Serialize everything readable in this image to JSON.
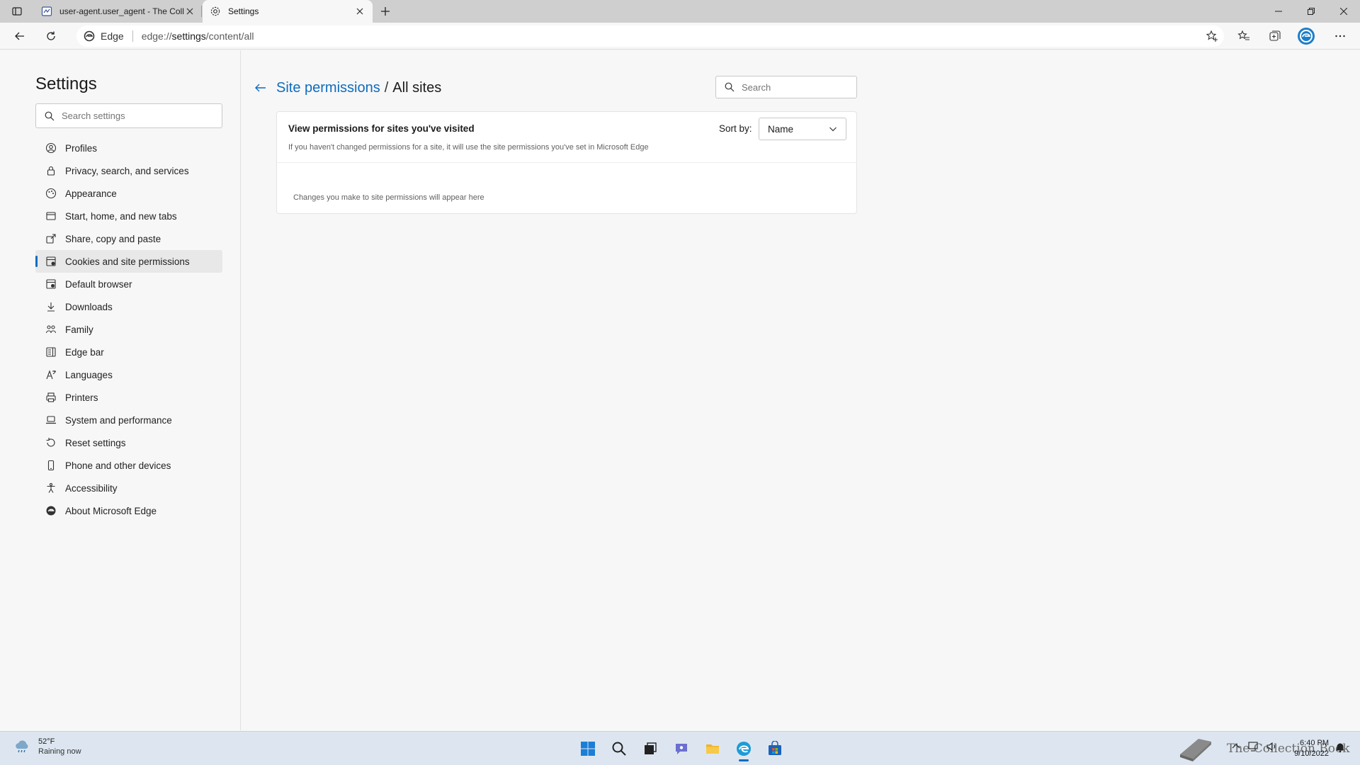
{
  "tabs": [
    {
      "title": "user-agent.user_agent - The Coll",
      "active": false
    },
    {
      "title": "Settings",
      "active": true
    }
  ],
  "toolbar": {
    "site_label": "Edge",
    "url_prefix": "edge://",
    "url_host": "settings",
    "url_path": "/content/all"
  },
  "sidebar": {
    "title": "Settings",
    "search_placeholder": "Search settings",
    "items": [
      {
        "label": "Profiles",
        "icon": "profile-icon"
      },
      {
        "label": "Privacy, search, and services",
        "icon": "lock-icon"
      },
      {
        "label": "Appearance",
        "icon": "appearance-icon"
      },
      {
        "label": "Start, home, and new tabs",
        "icon": "home-tabs-icon"
      },
      {
        "label": "Share, copy and paste",
        "icon": "share-icon"
      },
      {
        "label": "Cookies and site permissions",
        "icon": "cookies-icon",
        "selected": true
      },
      {
        "label": "Default browser",
        "icon": "browser-icon"
      },
      {
        "label": "Downloads",
        "icon": "download-icon"
      },
      {
        "label": "Family",
        "icon": "family-icon"
      },
      {
        "label": "Edge bar",
        "icon": "edge-bar-icon"
      },
      {
        "label": "Languages",
        "icon": "languages-icon"
      },
      {
        "label": "Printers",
        "icon": "printer-icon"
      },
      {
        "label": "System and performance",
        "icon": "laptop-icon"
      },
      {
        "label": "Reset settings",
        "icon": "reset-icon"
      },
      {
        "label": "Phone and other devices",
        "icon": "phone-icon"
      },
      {
        "label": "Accessibility",
        "icon": "accessibility-icon"
      },
      {
        "label": "About Microsoft Edge",
        "icon": "edge-logo-icon"
      }
    ]
  },
  "main": {
    "breadcrumb_link": "Site permissions",
    "breadcrumb_sep": "/",
    "breadcrumb_current": "All sites",
    "search_placeholder": "Search",
    "card": {
      "title": "View permissions for sites you've visited",
      "description": "If you haven't changed permissions for a site, it will use the site permissions you've set in Microsoft Edge",
      "sort_label": "Sort by:",
      "sort_value": "Name",
      "empty_text": "Changes you make to site permissions will appear here"
    }
  },
  "taskbar": {
    "weather_temp": "52°F",
    "weather_desc": "Raining now",
    "time": "6:40 PM",
    "date": "9/10/2022",
    "watermark": "The Collection Book"
  },
  "colors": {
    "accent": "#0f6cbd",
    "tabstrip": "#cfcfcf",
    "taskbar": "#dde6f0"
  }
}
